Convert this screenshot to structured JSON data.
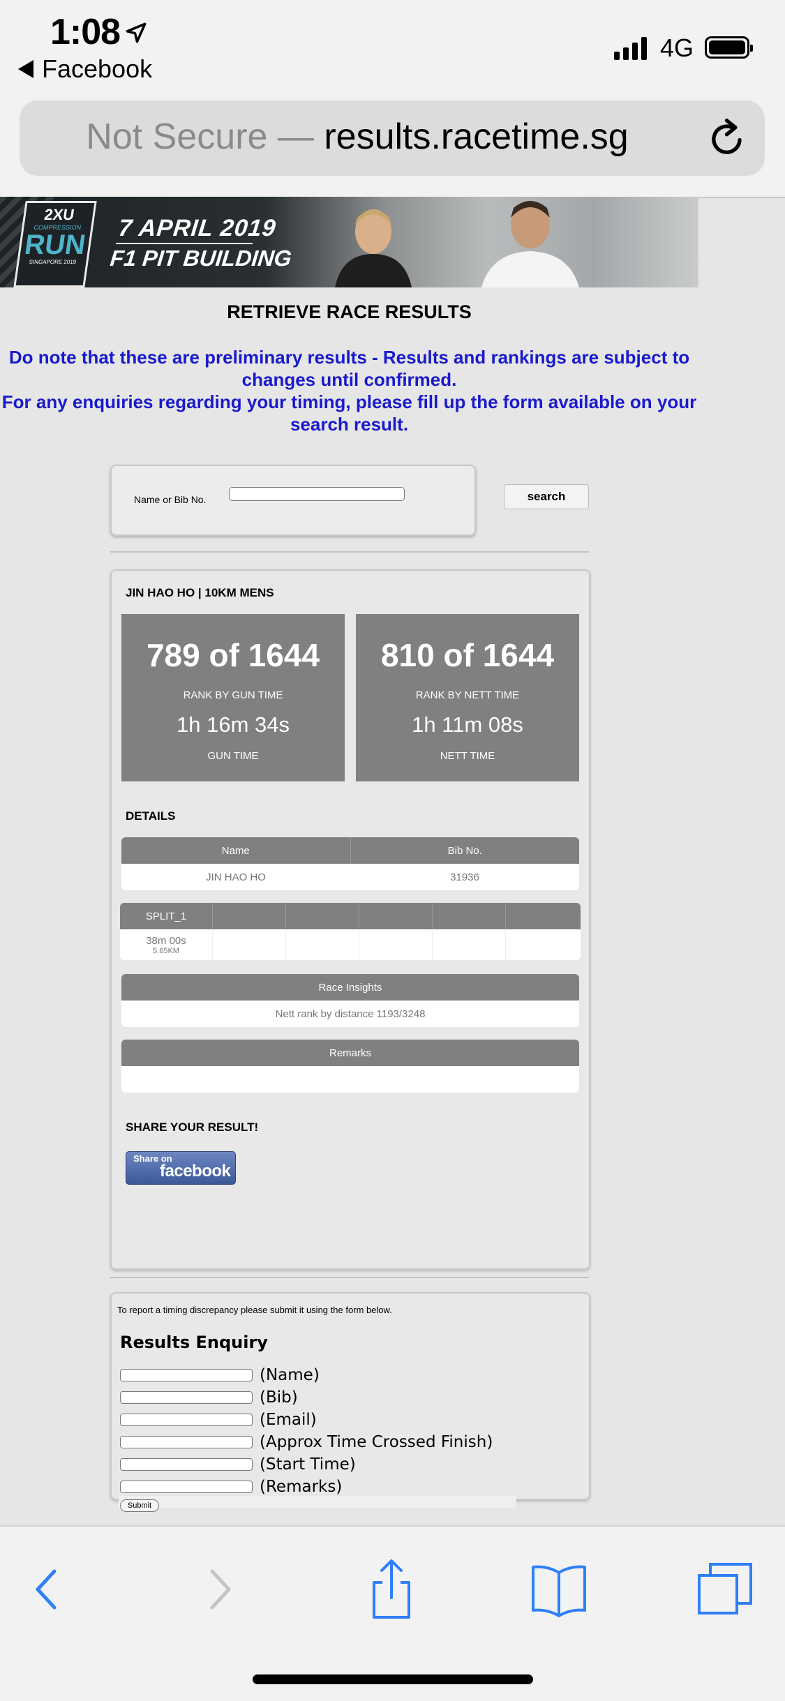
{
  "status_bar": {
    "time": "1:08",
    "back_app": "Facebook",
    "network": "4G"
  },
  "browser": {
    "url_prefix": "Not Secure —",
    "url_domain": "results.racetime.sg"
  },
  "banner": {
    "logo_brand": "2XU",
    "logo_sub": "COMPRESSION",
    "logo_run": "RUN",
    "logo_loc": "SINGAPORE 2019",
    "date": "7 APRIL 2019",
    "venue": "F1 PIT BUILDING"
  },
  "page": {
    "title": "RETRIEVE RACE RESULTS",
    "notice_line1": "Do note that these are preliminary results - Results and rankings are subject to changes until confirmed.",
    "notice_line2": "For any enquiries regarding your timing, please fill up the form available on your search result."
  },
  "search": {
    "label": "Name or Bib No.",
    "value": "",
    "button": "search"
  },
  "result": {
    "header": "JIN HAO HO | 10KM MENS",
    "gun": {
      "rank": "789 of 1644",
      "rank_caption": "RANK BY GUN TIME",
      "time": "1h 16m 34s",
      "time_caption": "GUN TIME"
    },
    "nett": {
      "rank": "810 of 1644",
      "rank_caption": "RANK BY NETT TIME",
      "time": "1h 11m 08s",
      "time_caption": "NETT TIME"
    },
    "details_heading": "DETAILS",
    "details_cols": [
      "Name",
      "Bib No."
    ],
    "details_row": [
      "JIN HAO HO",
      "31936"
    ],
    "split_col": "SPLIT_1",
    "split_time": "38m 00s",
    "split_dist": "5.65KM",
    "insights_heading": "Race Insights",
    "insights_text": "Nett rank by distance 1193/3248",
    "remarks_heading": "Remarks",
    "remarks_text": "",
    "share_heading": "SHARE YOUR RESULT!",
    "share_small": "Share on",
    "share_big": "facebook"
  },
  "enquiry": {
    "note": "To report a timing discrepancy please submit it using the form below.",
    "title": "Results Enquiry",
    "fields": [
      "(Name)",
      "(Bib)",
      "(Email)",
      "(Approx Time Crossed Finish)",
      "(Start Time)",
      "(Remarks)"
    ],
    "submit": "Submit"
  },
  "colors": {
    "notice_blue": "#1a1acc",
    "panel_grey": "#808080",
    "fb_blue": "#3b5998",
    "ios_blue": "#2f7ff7"
  }
}
